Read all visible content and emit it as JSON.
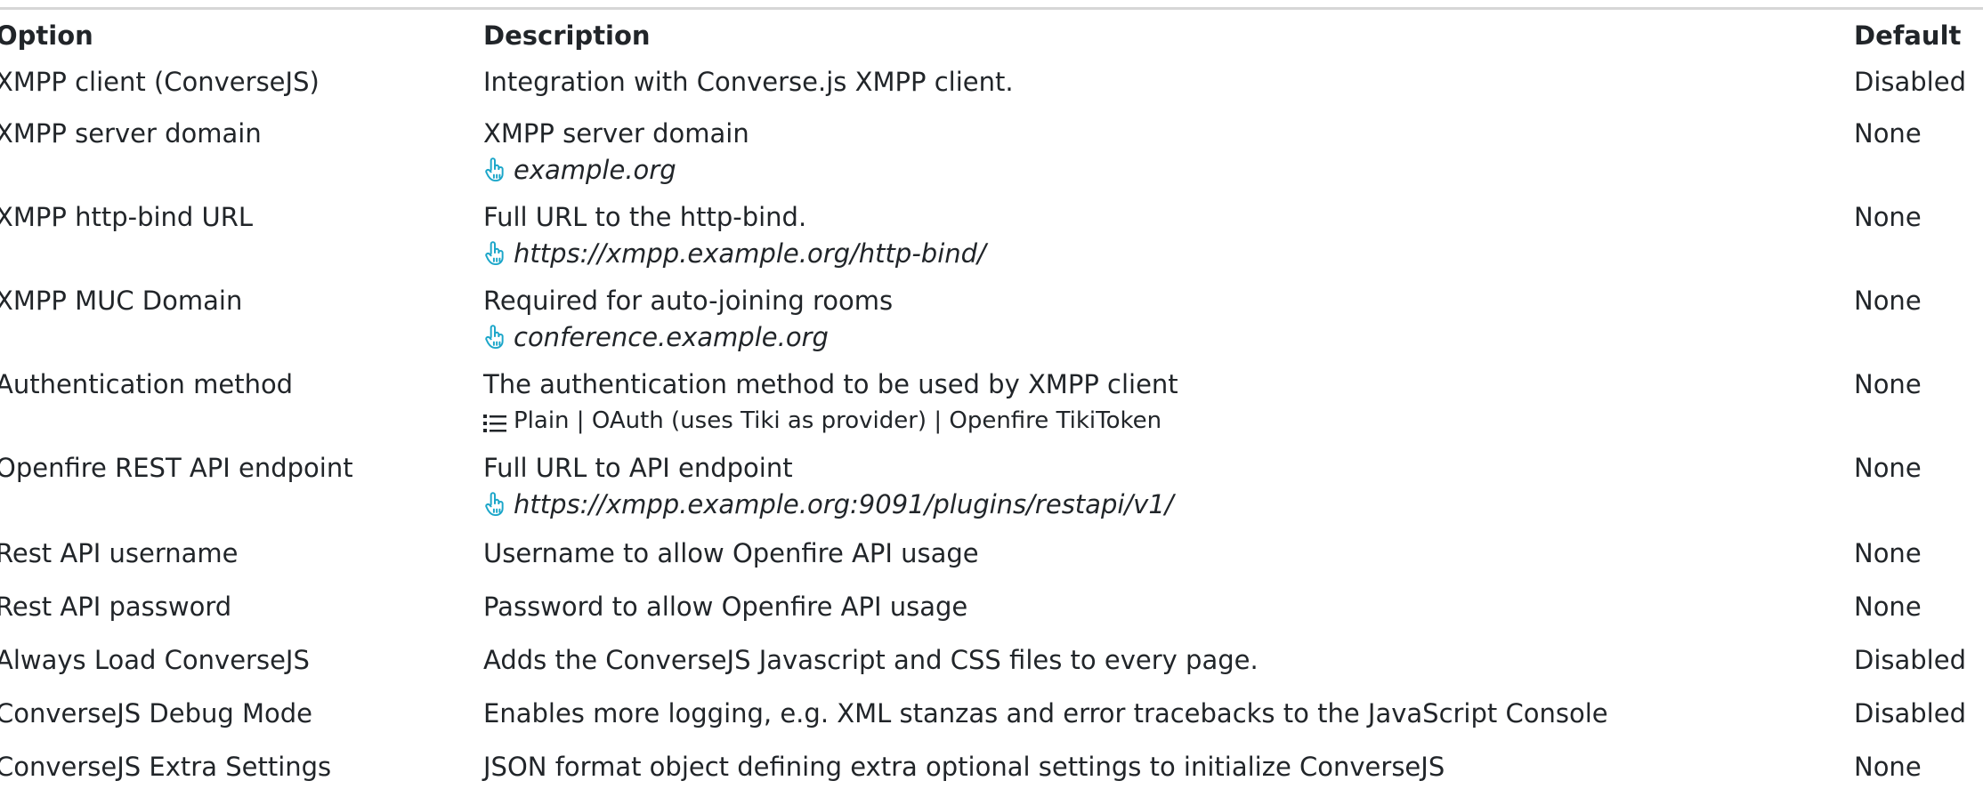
{
  "table": {
    "headers": {
      "option": "Option",
      "description": "Description",
      "default": "Default"
    },
    "rows": [
      {
        "option": "XMPP client (ConverseJS)",
        "description": "Integration with Converse.js XMPP client.",
        "example": "",
        "choices": "",
        "default": "Disabled"
      },
      {
        "option": "XMPP server domain",
        "description": "XMPP server domain",
        "example": "example.org",
        "choices": "",
        "default": "None"
      },
      {
        "option": "XMPP http-bind URL",
        "description": "Full URL to the http-bind.",
        "example": "https://xmpp.example.org/http-bind/",
        "choices": "",
        "default": "None"
      },
      {
        "option": "XMPP MUC Domain",
        "description": "Required for auto-joining rooms",
        "example": "conference.example.org",
        "choices": "",
        "default": "None"
      },
      {
        "option": "Authentication method",
        "description": "The authentication method to be used by XMPP client",
        "example": "",
        "choices": "Plain | OAuth (uses Tiki as provider) | Openfire TikiToken",
        "default": "None"
      },
      {
        "option": "Openfire REST API endpoint",
        "description": "Full URL to API endpoint",
        "example": "https://xmpp.example.org:9091/plugins/restapi/v1/",
        "choices": "",
        "default": "None"
      },
      {
        "option": "Rest API username",
        "description": "Username to allow Openfire API usage",
        "example": "",
        "choices": "",
        "default": "None"
      },
      {
        "option": "Rest API password",
        "description": "Password to allow Openfire API usage",
        "example": "",
        "choices": "",
        "default": "None"
      },
      {
        "option": "Always Load ConverseJS",
        "description": "Adds the ConverseJS Javascript and CSS files to every page.",
        "example": "",
        "choices": "",
        "default": "Disabled"
      },
      {
        "option": "ConverseJS Debug Mode",
        "description": "Enables more logging, e.g. XML stanzas and error tracebacks to the JavaScript Console",
        "example": "",
        "choices": "",
        "default": "Disabled"
      },
      {
        "option": "ConverseJS Extra Settings",
        "description": "JSON format object defining extra optional settings to initialize ConverseJS",
        "example": "",
        "choices": "",
        "default": "None"
      }
    ]
  },
  "icons": {
    "example": "pointing-hand-icon",
    "choices": "list-icon",
    "accent_color": "#1ba6c9"
  }
}
